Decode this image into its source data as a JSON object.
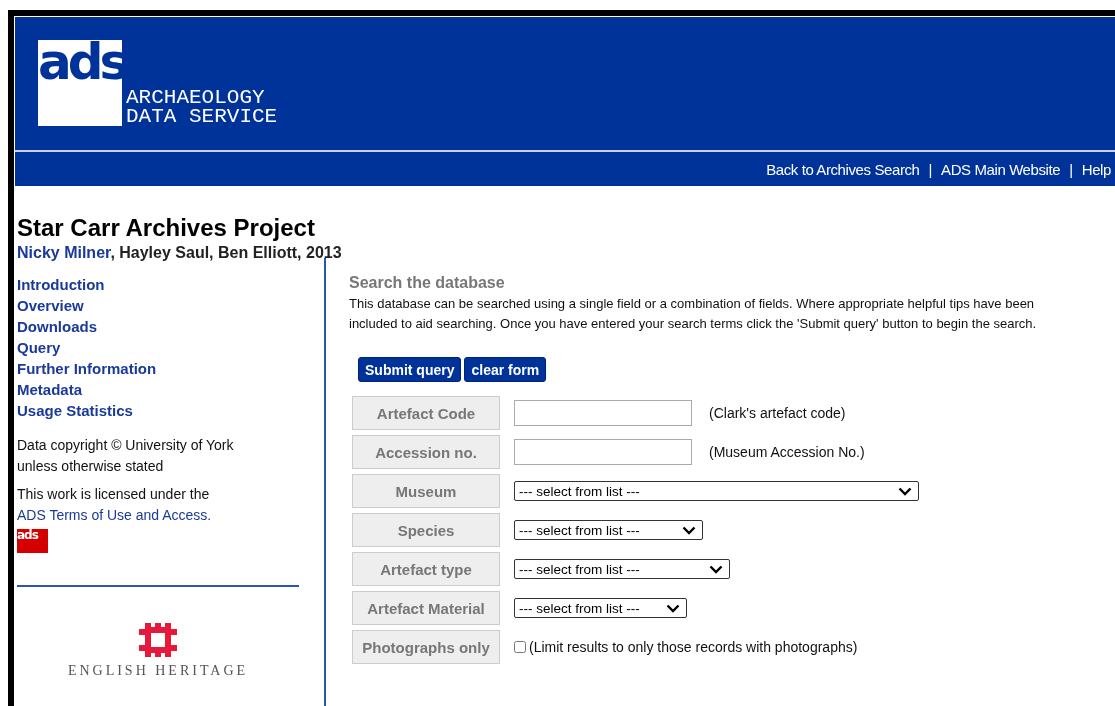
{
  "header": {
    "logo": "ads",
    "service_name": [
      "ARCHAEOLOGY",
      "DATA SERVICE"
    ]
  },
  "nav_links": [
    "Back to Archives Search",
    "ADS Main Website",
    "Help"
  ],
  "nav_separator": "|",
  "project": {
    "title": "Star Carr Archives Project",
    "author_link": "Nicky Milner",
    "authors_rest": ", Hayley Saul, Ben Elliott, 2013"
  },
  "sidebar": {
    "items": [
      "Introduction",
      "Overview",
      "Downloads",
      "Query",
      "Further Information",
      "Metadata",
      "Usage Statistics"
    ],
    "copyright": [
      "Data copyright © University of York",
      "unless otherwise stated"
    ],
    "license_text": "This work is licensed under the",
    "license_link": "ADS Terms of Use and Access.",
    "small_logo": "ads",
    "partner_logo": "ENGLISH HERITAGE"
  },
  "search": {
    "heading": "Search the database",
    "intro": "This database can be searched using a single field or a combination of fields. Where appropriate helpful tips have been included to aid searching. Once you have entered your search terms click the 'Submit query' button to begin the search.",
    "buttons": [
      "Submit query",
      "clear form"
    ],
    "fields": [
      {
        "kind": "text",
        "label": "Artefact Code",
        "hint": "(Clark's artefact code)"
      },
      {
        "kind": "text",
        "label": "Accession no.",
        "hint": "(Museum Accession No.)"
      },
      {
        "kind": "select",
        "label": "Museum",
        "value": "--- select from list ---"
      },
      {
        "kind": "select",
        "label": "Species",
        "value": "--- select from list ---"
      },
      {
        "kind": "select",
        "label": "Artefact type",
        "value": "--- select from list ---"
      },
      {
        "kind": "select",
        "label": "Artefact Material",
        "value": "--- select from list ---"
      },
      {
        "kind": "checkbox",
        "label": "Photographs only",
        "checked": false,
        "hint": "(Limit results to only those records with photographs)"
      }
    ]
  }
}
